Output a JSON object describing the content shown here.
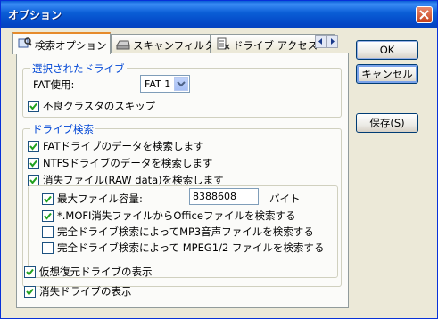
{
  "window": {
    "title": "オプション"
  },
  "tabs": [
    {
      "label": "検索オプション",
      "active": true
    },
    {
      "label": "スキャンフィルタ",
      "active": false
    },
    {
      "label": "ドライブ アクセス",
      "active": false
    }
  ],
  "selected_drive": {
    "group_label": "選択されたドライブ",
    "fat_label": "FAT使用:",
    "fat_value": "FAT 1",
    "skip_bad_clusters": {
      "label": "不良クラスタのスキップ",
      "checked": true
    }
  },
  "drive_search": {
    "group_label": "ドライブ検索",
    "search_fat": {
      "label": "FATドライブのデータを検索します",
      "checked": true
    },
    "search_ntfs": {
      "label": "NTFSドライブのデータを検索します",
      "checked": true
    },
    "search_raw": {
      "label": "消失ファイル(RAW data)を検索します",
      "checked": true
    },
    "max_file_size": {
      "label": "最大ファイル容量:",
      "checked": true,
      "value": "8388608",
      "unit": "バイト"
    },
    "mof_office": {
      "label": "*.MOFI消失ファイルからOfficeファイルを検索する",
      "checked": true
    },
    "mp3_search": {
      "label": "完全ドライブ検索によってMP3音声ファイルを検索する",
      "checked": false
    },
    "mpeg_search": {
      "label": "完全ドライブ検索によって MPEG1/2 ファイルを検索する",
      "checked": false
    }
  },
  "virtual_drives": {
    "label": "仮想復元ドライブの表示",
    "checked": true
  },
  "lost_drives": {
    "label": "消失ドライブの表示",
    "checked": true
  },
  "buttons": {
    "ok": "OK",
    "cancel": "キャンセル",
    "save": "保存(S)"
  }
}
